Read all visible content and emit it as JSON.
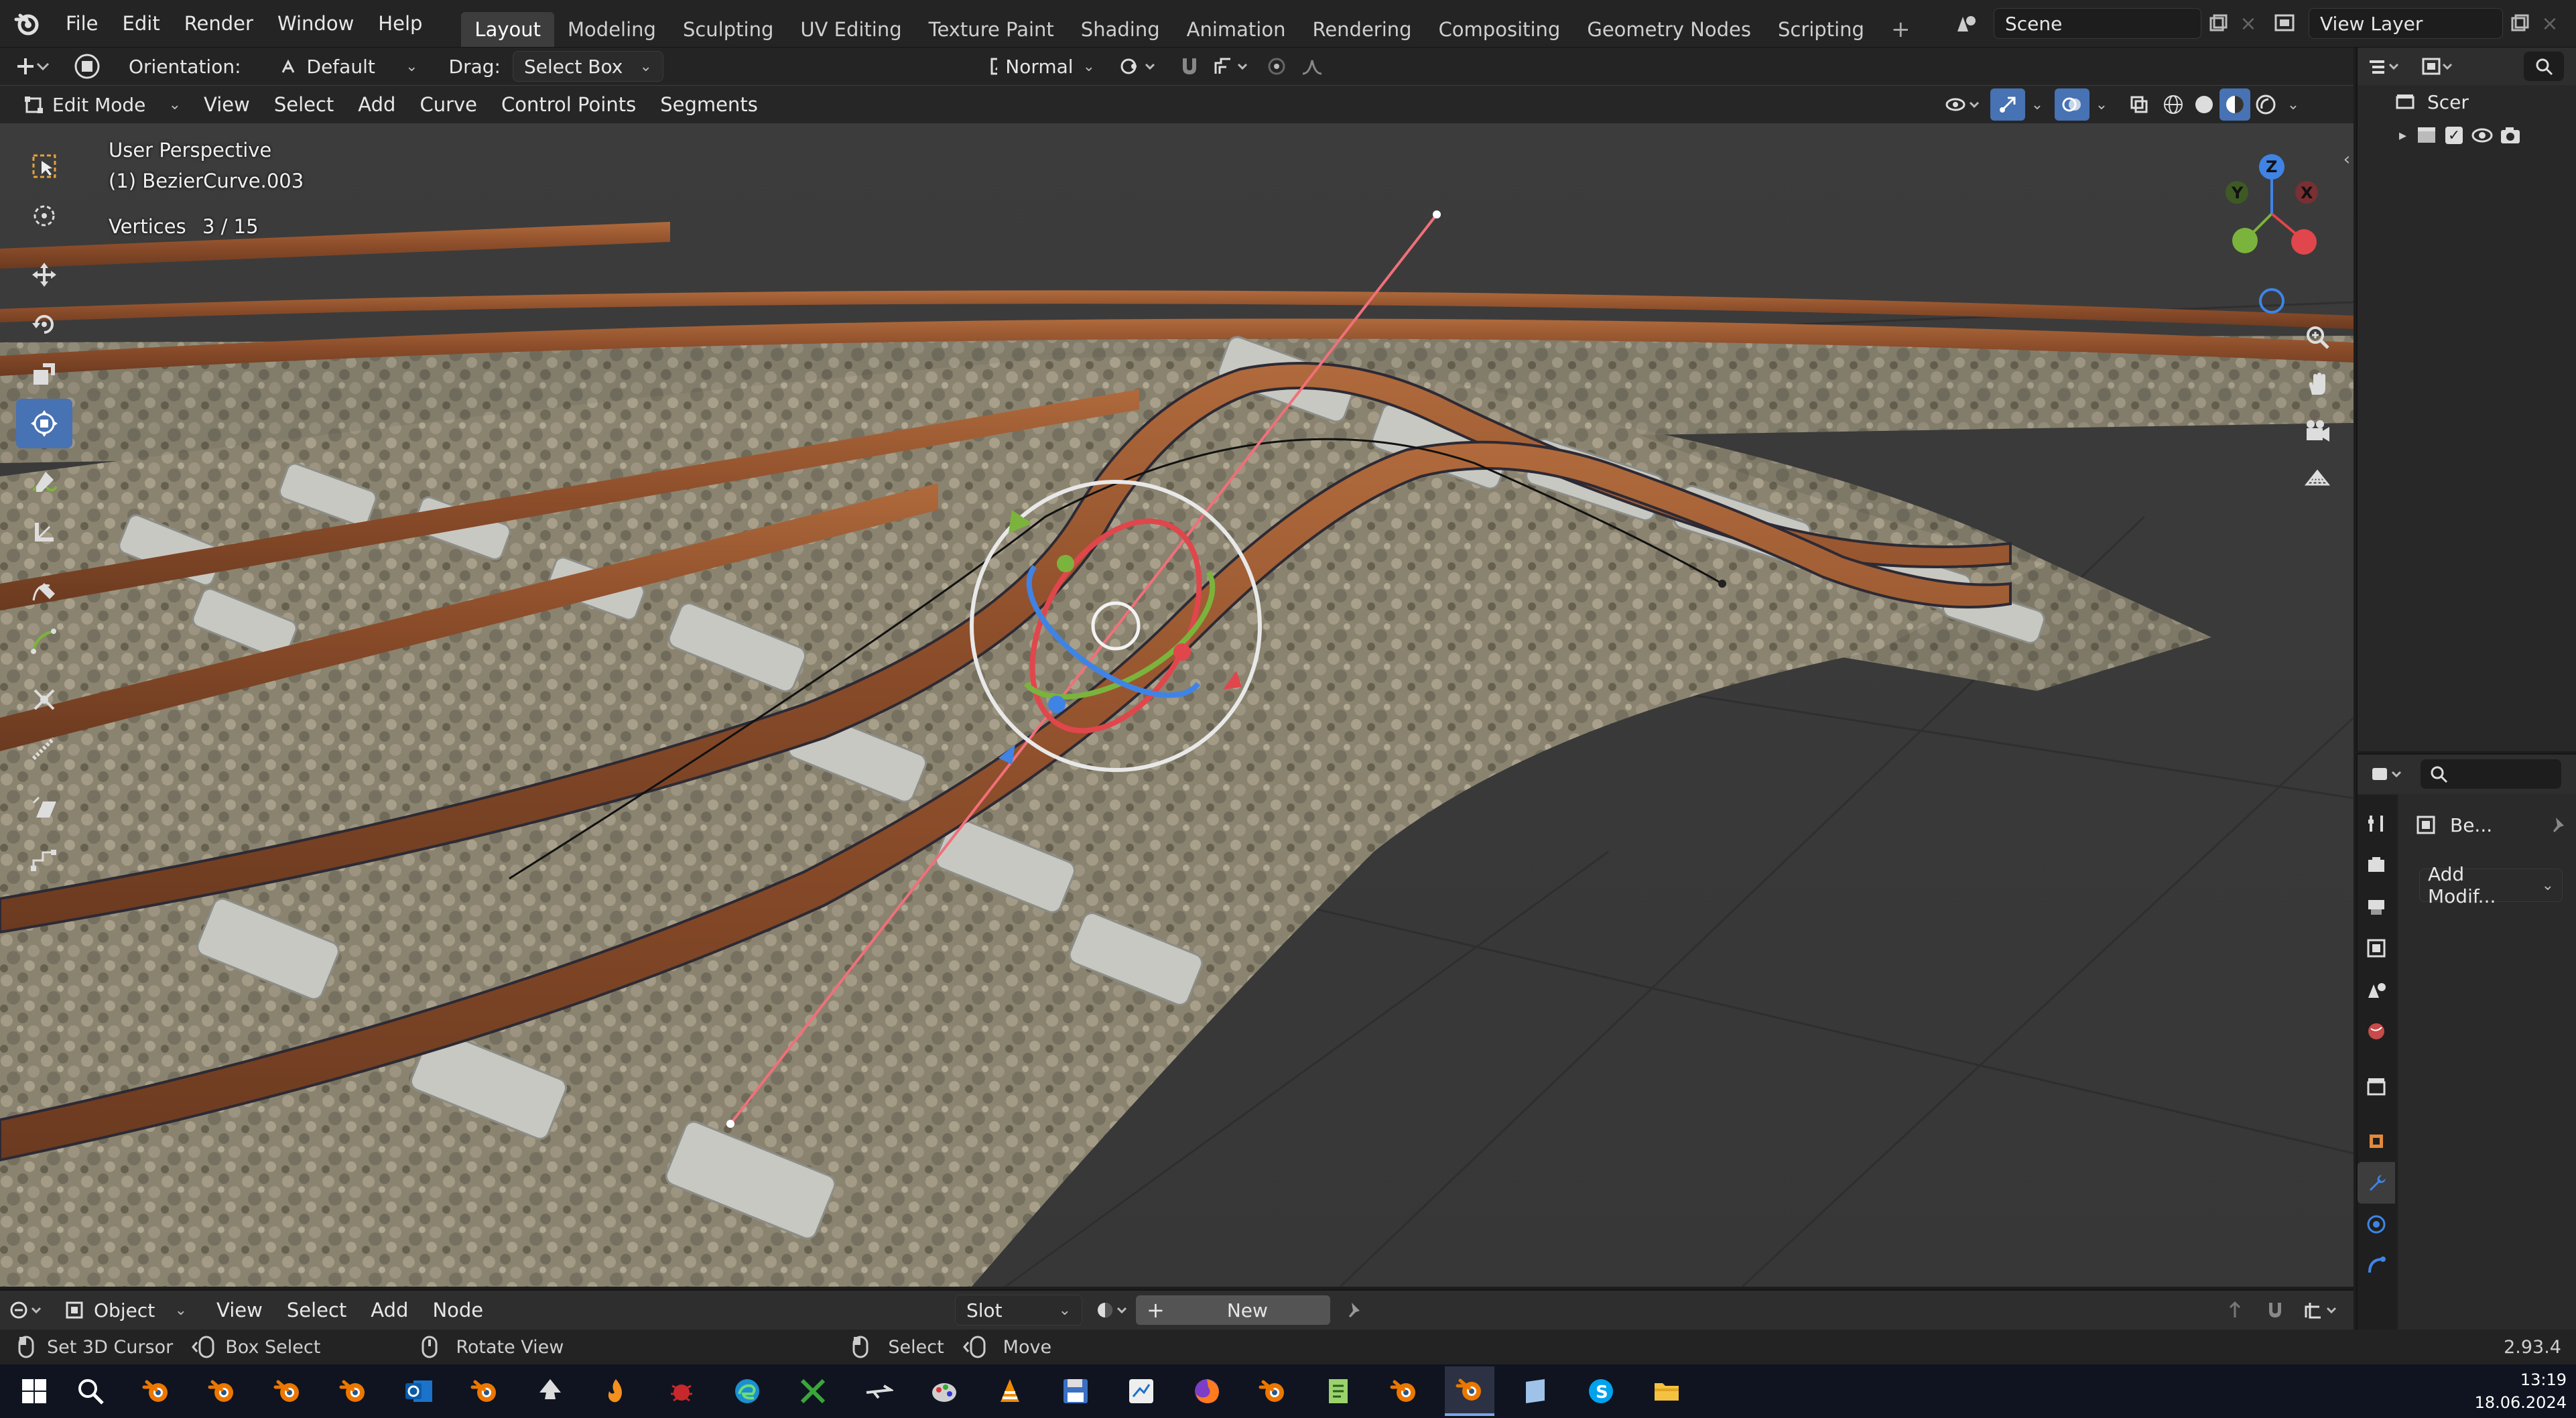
{
  "topbar": {
    "menus": [
      "File",
      "Edit",
      "Render",
      "Window",
      "Help"
    ],
    "workspaces": [
      "Layout",
      "Modeling",
      "Sculpting",
      "UV Editing",
      "Texture Paint",
      "Shading",
      "Animation",
      "Rendering",
      "Compositing",
      "Geometry Nodes",
      "Scripting"
    ],
    "active_workspace": "Layout",
    "scene_name": "Scene",
    "view_layer": "View Layer"
  },
  "tool_header": {
    "orientation_label": "Orientation:",
    "orientation_value": "Default",
    "drag_label": "Drag:",
    "drag_value": "Select Box",
    "pivot_value": "Normal"
  },
  "viewport_header": {
    "mode": "Edit Mode",
    "menus": [
      "View",
      "Select",
      "Add",
      "Curve",
      "Control Points",
      "Segments"
    ]
  },
  "viewport": {
    "perspective": "User Perspective",
    "object_name": "(1) BezierCurve.003",
    "stats_label": "Vertices",
    "stats_value": "3 / 15"
  },
  "gizmo_axes": {
    "z": "Z",
    "y": "Y",
    "x": "X"
  },
  "outliner": {
    "item_label": "Scer"
  },
  "properties": {
    "object_label": "Be...",
    "add_modifier": "Add Modif..."
  },
  "shader_header": {
    "mode": "Object",
    "menus": [
      "View",
      "Select",
      "Add",
      "Node"
    ],
    "slot": "Slot",
    "new_button": "New"
  },
  "statusbar": {
    "hints": [
      {
        "icon": "mouse-left-icon",
        "text": "Set 3D Cursor"
      },
      {
        "icon": "mouse-drag-icon",
        "text": "Box Select"
      },
      {
        "icon": "mouse-middle-icon",
        "text": "Rotate View"
      },
      {
        "icon": "mouse-left-icon",
        "text": "Select"
      },
      {
        "icon": "mouse-drag-icon",
        "text": "Move"
      }
    ],
    "version": "2.93.4"
  },
  "taskbar": {
    "time": "13:19",
    "date": "18.06.2024"
  },
  "colors": {
    "accent": "#4772b3",
    "panel": "#232323",
    "header": "#2e2e2e",
    "rail": "#9a5a34",
    "axis_x": "#e0464b",
    "axis_y": "#7bb43c",
    "axis_z": "#3f84e5"
  }
}
